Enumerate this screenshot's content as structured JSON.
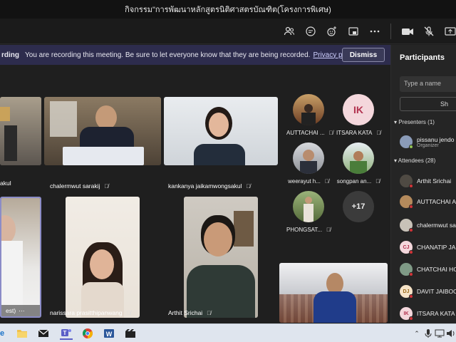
{
  "window": {
    "title": "กิจกรรม\"การพัฒนาหลักสูตรนิติศาสตรบัณฑิต(โครงการพิเศษ)"
  },
  "toolbar": {
    "icons": [
      "people-icon",
      "chat-icon",
      "reactions-icon",
      "share-icon",
      "more-icon",
      "camera-icon",
      "mic-off-icon",
      "share-tray-icon"
    ]
  },
  "banner": {
    "prefix": "rding",
    "message": "You are recording this meeting. Be sure to let everyone know that they are being recorded.",
    "link": "Privacy policy",
    "dismiss_label": "Dismiss"
  },
  "tiles": [
    {
      "name": "akul"
    },
    {
      "name": "chalermwut sarakij"
    },
    {
      "name": "kankanya jaikamwongsakul"
    },
    {
      "name": "est)"
    },
    {
      "name": "narissara prasitthipanwang"
    },
    {
      "name": "Arthit Srichai"
    }
  ],
  "avatars": [
    {
      "name": "AUTTACHAI ..."
    },
    {
      "name": "ITSARA KATA",
      "initials": "IK"
    },
    {
      "name": "weerayut h..."
    },
    {
      "name": "songpan an..."
    },
    {
      "name": "PHONGSAT..."
    },
    {
      "name": "+17"
    }
  ],
  "participants": {
    "title": "Participants",
    "search_placeholder": "Type a name",
    "share_label": "Sh",
    "presenters_header": "Presenters (1)",
    "presenters": [
      {
        "name": "pissanu jendo",
        "role": "Organizer"
      }
    ],
    "attendees_header": "Attendees (28)",
    "attendees": [
      {
        "name": "Arthit Srichai"
      },
      {
        "name": "AUTTACHAI A"
      },
      {
        "name": "chalermwut sa"
      },
      {
        "name": "CHANATIP JA",
        "initials": "CJ"
      },
      {
        "name": "CHATCHAI HO"
      },
      {
        "name": "DAVIT JAIBOO",
        "initials": "DJ"
      },
      {
        "name": "ITSARA KATA",
        "initials": "IK"
      }
    ]
  },
  "colors": {
    "accent": "#6264a7",
    "banner_bg": "#2d2c4d",
    "recording_dot": "#d13438"
  }
}
